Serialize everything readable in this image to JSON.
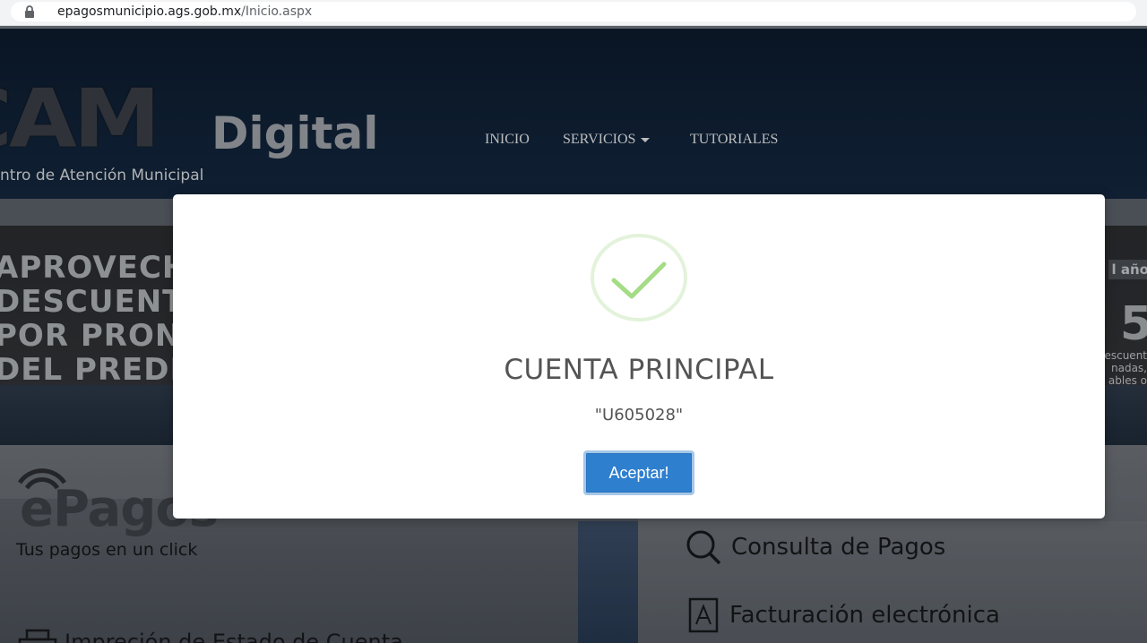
{
  "browser": {
    "url_host": "epagosmunicipio.ags.gob.mx",
    "url_path": "/Inicio.aspx"
  },
  "header": {
    "logo_cam": "CAM",
    "logo_digital": "Digital",
    "logo_subtitle": "ntro de Atención Municipal",
    "nav": [
      {
        "label": "INICIO"
      },
      {
        "label": "SERVICIOS"
      },
      {
        "label": "TUTORIALES"
      }
    ]
  },
  "banner": {
    "left_lines": [
      "APROVECH",
      "DESCUENTO",
      "POR PRONT",
      "DEL PREDIA"
    ],
    "right_label": "l año",
    "right_number": "5",
    "right_small": [
      "escuent",
      "nadas,",
      "ables o"
    ]
  },
  "content": {
    "epagos_word": "ePagos",
    "epagos_tagline": "Tus pagos en un click",
    "consulta_label": "Consulta de Pagos",
    "facturacion_label": "Facturación electrónica",
    "impresion_label": "Impreción de Estado de Cuenta"
  },
  "modal": {
    "title": "CUENTA PRINCIPAL",
    "text": "\"U605028\"",
    "button_label": "Aceptar!",
    "icon": "success-check-icon",
    "accent_color": "#a5dc86",
    "button_color": "#2f7fcf"
  }
}
